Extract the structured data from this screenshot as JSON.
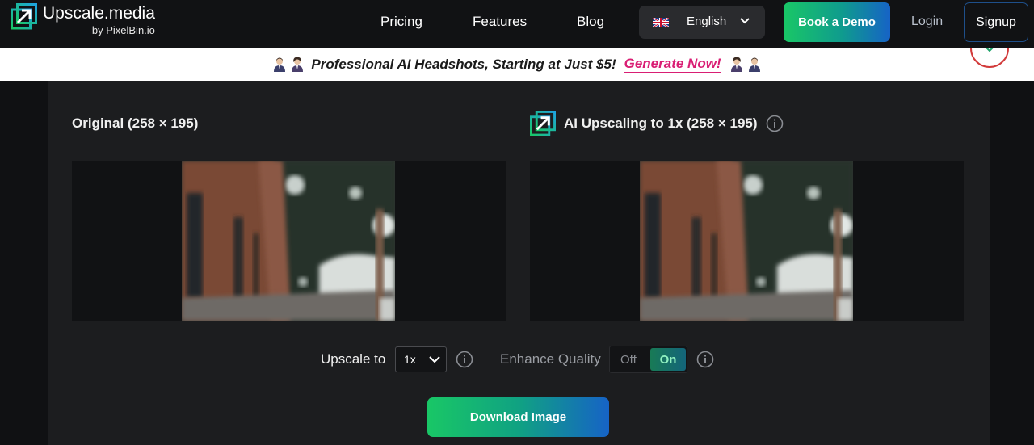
{
  "header": {
    "logo_title": "Upscale.media",
    "logo_sub": "by PixelBin.io",
    "nav": [
      "Pricing",
      "Features",
      "Blog"
    ],
    "language": "English",
    "book_demo": "Book a Demo",
    "login": "Login",
    "signup": "Signup"
  },
  "banner": {
    "text": "Professional AI Headshots, Starting at Just $5!",
    "link": "Generate Now!"
  },
  "main": {
    "original_title": "Original (258 × 195)",
    "upscaled_title": "AI Upscaling to 1x (258 × 195)"
  },
  "controls": {
    "upscale_label": "Upscale to",
    "upscale_value": "1x",
    "enhance_label": "Enhance Quality",
    "toggle_off": "Off",
    "toggle_on": "On",
    "enhance_enabled": true,
    "download": "Download Image"
  },
  "colors": {
    "accent_green": "#19c766",
    "accent_blue": "#1663c6",
    "banner_link": "#d91e74",
    "background": "#101113",
    "panel": "#1c1d1f"
  },
  "icons": [
    "upscale-logo-icon",
    "uk-flag-icon",
    "chevron-down-icon",
    "person-icon",
    "close-icon",
    "info-icon"
  ]
}
